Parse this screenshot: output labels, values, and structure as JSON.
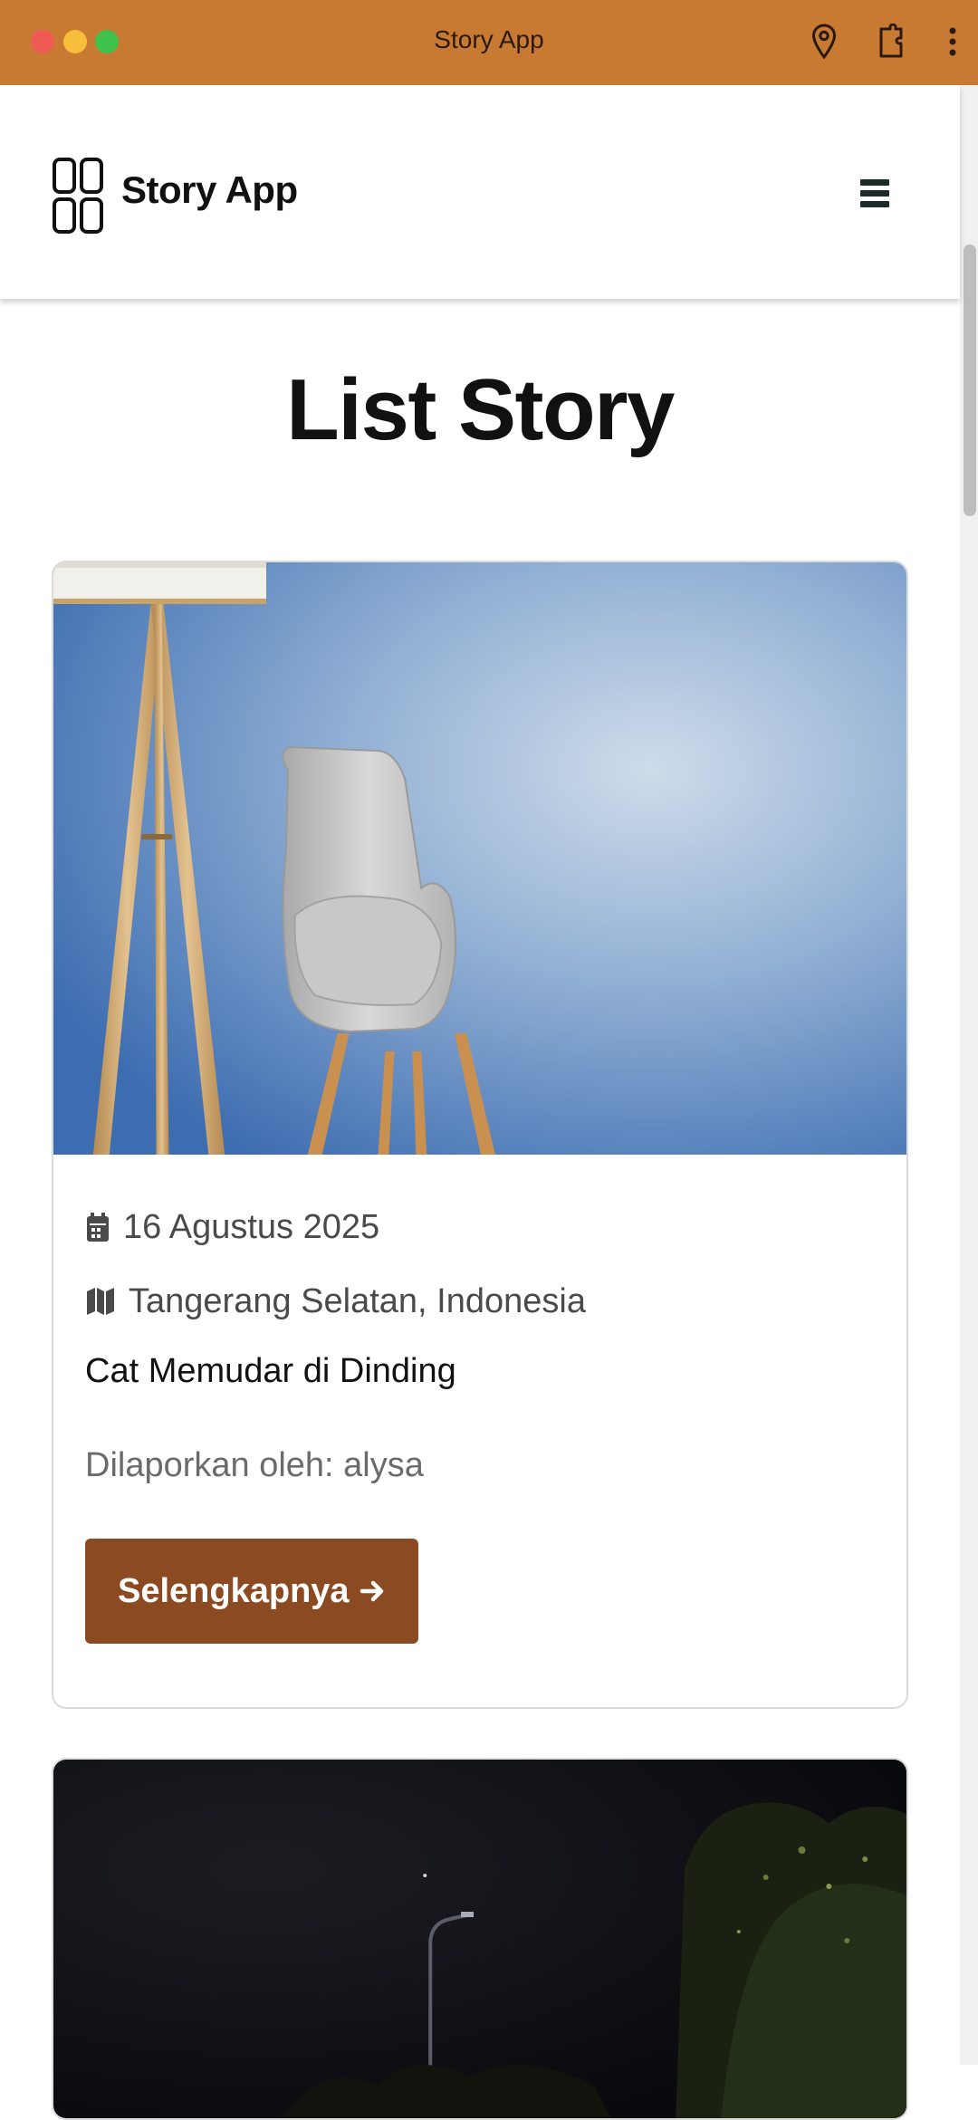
{
  "window": {
    "title": "Story App",
    "accent": "#c87a33",
    "icons": [
      "location-pin-icon",
      "extension-icon",
      "more-vert-icon"
    ]
  },
  "header": {
    "brand": "Story App",
    "logo_icon": "grid-logo-icon",
    "menu_icon": "hamburger-icon"
  },
  "main": {
    "title": "List Story",
    "stories": [
      {
        "date": "16 Agustus 2025",
        "location": "Tangerang Selatan, Indonesia",
        "title": "Cat Memudar di Dinding",
        "reporter": "Dilaporkan oleh: alysa",
        "button_label": "Selengkapnya",
        "image_subject": "grey chair and floor lamp against faded blue wall"
      },
      {
        "image_subject": "night sky with street lamp and trees"
      }
    ],
    "button_color": "#8b4a21"
  }
}
